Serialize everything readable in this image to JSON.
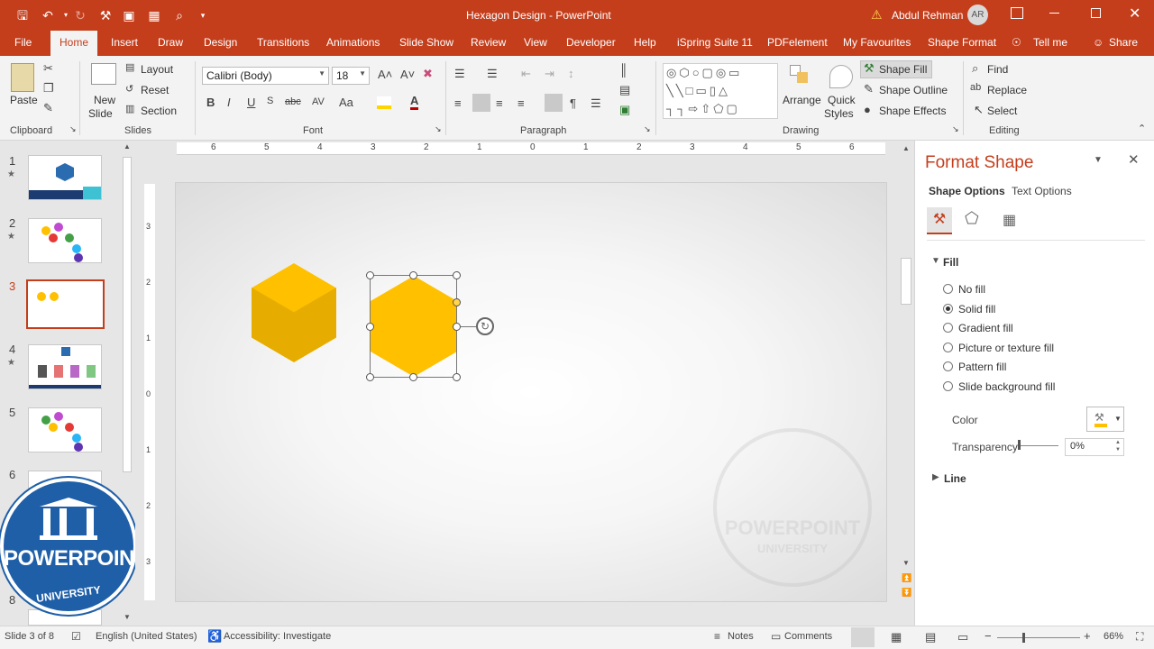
{
  "window": {
    "doc_title": "Hexagon Design - PowerPoint",
    "user_name": "Abdul Rehman",
    "user_initials": "AR"
  },
  "tabs": [
    "File",
    "Home",
    "Insert",
    "Draw",
    "Design",
    "Transitions",
    "Animations",
    "Slide Show",
    "Review",
    "View",
    "Developer",
    "Help",
    "iSpring Suite 11",
    "PDFelement",
    "My Favourites",
    "Shape Format"
  ],
  "tell_me": "Tell me",
  "share": "Share",
  "ribbon": {
    "clipboard": {
      "paste": "Paste",
      "group": "Clipboard"
    },
    "slides": {
      "new_slide_1": "New",
      "new_slide_2": "Slide",
      "layout": "Layout",
      "reset": "Reset",
      "section": "Section",
      "group": "Slides"
    },
    "font": {
      "name": "Calibri (Body)",
      "size": "18",
      "bold": "B",
      "italic": "I",
      "underline": "U",
      "strike": "abc",
      "group": "Font"
    },
    "paragraph": {
      "group": "Paragraph"
    },
    "drawing": {
      "arrange": "Arrange",
      "quick_styles_1": "Quick",
      "quick_styles_2": "Styles",
      "shape_fill": "Shape Fill",
      "shape_outline": "Shape Outline",
      "shape_effects": "Shape Effects",
      "group": "Drawing"
    },
    "editing": {
      "find": "Find",
      "replace": "Replace",
      "select": "Select",
      "group": "Editing"
    }
  },
  "slides_panel": {
    "numbers": [
      "1",
      "2",
      "3",
      "4",
      "5",
      "6",
      "8"
    ],
    "selected": "3"
  },
  "ruler": {
    "h_ticks": [
      "6",
      "5",
      "4",
      "3",
      "2",
      "1",
      "0",
      "1",
      "2",
      "3",
      "4",
      "5",
      "6"
    ],
    "v_ticks": [
      "3",
      "2",
      "1",
      "0",
      "1",
      "2",
      "3"
    ]
  },
  "format_pane": {
    "title": "Format Shape",
    "tab_shape": "Shape Options",
    "tab_text": "Text Options",
    "fill_header": "Fill",
    "options": [
      "No fill",
      "Solid fill",
      "Gradient fill",
      "Picture or texture fill",
      "Pattern fill",
      "Slide background fill"
    ],
    "selected_option": "Solid fill",
    "color_label": "Color",
    "transparency_label": "Transparency",
    "transparency_value": "0%",
    "line_header": "Line"
  },
  "watermark": {
    "line1": "POWERPOINT",
    "line2": "UNIVERSITY"
  },
  "status": {
    "slide_of": "Slide 3 of 8",
    "language": "English (United States)",
    "accessibility": "Accessibility: Investigate",
    "notes": "Notes",
    "comments": "Comments",
    "zoom": "66%"
  },
  "colors": {
    "brand": "#c43e1c",
    "hexagon": "#ffc000",
    "hexagon_shade": "#e0a800",
    "watermark_blue": "#1f5fa8"
  }
}
